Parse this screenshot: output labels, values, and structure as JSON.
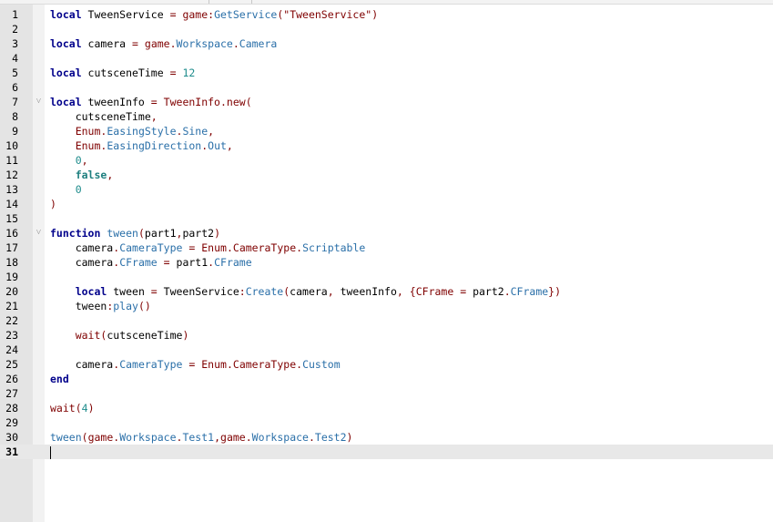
{
  "editor": {
    "current_line": "31",
    "lines": [
      {
        "n": "1",
        "tokens": [
          {
            "t": "local",
            "c": "kw"
          },
          {
            "t": " TweenService ",
            "c": "id"
          },
          {
            "t": "=",
            "c": "op"
          },
          {
            "t": " ",
            "c": "id"
          },
          {
            "t": "game",
            "c": "gl"
          },
          {
            "t": ":",
            "c": "op"
          },
          {
            "t": "GetService",
            "c": "mb"
          },
          {
            "t": "(",
            "c": "pn"
          },
          {
            "t": "\"TweenService\"",
            "c": "st"
          },
          {
            "t": ")",
            "c": "pn"
          }
        ]
      },
      {
        "n": "2",
        "tokens": []
      },
      {
        "n": "3",
        "tokens": [
          {
            "t": "local",
            "c": "kw"
          },
          {
            "t": " camera ",
            "c": "id"
          },
          {
            "t": "=",
            "c": "op"
          },
          {
            "t": " ",
            "c": "id"
          },
          {
            "t": "game",
            "c": "gl"
          },
          {
            "t": ".",
            "c": "op"
          },
          {
            "t": "Workspace",
            "c": "mb"
          },
          {
            "t": ".",
            "c": "op"
          },
          {
            "t": "Camera",
            "c": "mb"
          }
        ]
      },
      {
        "n": "4",
        "tokens": []
      },
      {
        "n": "5",
        "tokens": [
          {
            "t": "local",
            "c": "kw"
          },
          {
            "t": " cutsceneTime ",
            "c": "id"
          },
          {
            "t": "=",
            "c": "op"
          },
          {
            "t": " ",
            "c": "id"
          },
          {
            "t": "12",
            "c": "nm"
          }
        ]
      },
      {
        "n": "6",
        "tokens": []
      },
      {
        "n": "7",
        "fold": "˅",
        "tokens": [
          {
            "t": "local",
            "c": "kw"
          },
          {
            "t": " tweenInfo ",
            "c": "id"
          },
          {
            "t": "=",
            "c": "op"
          },
          {
            "t": " ",
            "c": "id"
          },
          {
            "t": "TweenInfo",
            "c": "gl"
          },
          {
            "t": ".",
            "c": "op"
          },
          {
            "t": "new",
            "c": "gl"
          },
          {
            "t": "(",
            "c": "pn"
          }
        ]
      },
      {
        "n": "8",
        "tokens": [
          {
            "t": "    cutsceneTime",
            "c": "id"
          },
          {
            "t": ",",
            "c": "op"
          }
        ]
      },
      {
        "n": "9",
        "tokens": [
          {
            "t": "    ",
            "c": "id"
          },
          {
            "t": "Enum",
            "c": "gl"
          },
          {
            "t": ".",
            "c": "op"
          },
          {
            "t": "EasingStyle",
            "c": "mb"
          },
          {
            "t": ".",
            "c": "op"
          },
          {
            "t": "Sine",
            "c": "mb"
          },
          {
            "t": ",",
            "c": "op"
          }
        ]
      },
      {
        "n": "10",
        "tokens": [
          {
            "t": "    ",
            "c": "id"
          },
          {
            "t": "Enum",
            "c": "gl"
          },
          {
            "t": ".",
            "c": "op"
          },
          {
            "t": "EasingDirection",
            "c": "mb"
          },
          {
            "t": ".",
            "c": "op"
          },
          {
            "t": "Out",
            "c": "mb"
          },
          {
            "t": ",",
            "c": "op"
          }
        ]
      },
      {
        "n": "11",
        "tokens": [
          {
            "t": "    ",
            "c": "id"
          },
          {
            "t": "0",
            "c": "nm"
          },
          {
            "t": ",",
            "c": "op"
          }
        ]
      },
      {
        "n": "12",
        "tokens": [
          {
            "t": "    ",
            "c": "id"
          },
          {
            "t": "false",
            "c": "bool"
          },
          {
            "t": ",",
            "c": "op"
          }
        ]
      },
      {
        "n": "13",
        "tokens": [
          {
            "t": "    ",
            "c": "id"
          },
          {
            "t": "0",
            "c": "nm"
          }
        ]
      },
      {
        "n": "14",
        "tokens": [
          {
            "t": ")",
            "c": "pn"
          }
        ]
      },
      {
        "n": "15",
        "tokens": []
      },
      {
        "n": "16",
        "fold": "˅",
        "tokens": [
          {
            "t": "function",
            "c": "kw"
          },
          {
            "t": " ",
            "c": "id"
          },
          {
            "t": "tween",
            "c": "fn"
          },
          {
            "t": "(",
            "c": "pn"
          },
          {
            "t": "part1",
            "c": "id"
          },
          {
            "t": ",",
            "c": "op"
          },
          {
            "t": "part2",
            "c": "id"
          },
          {
            "t": ")",
            "c": "pn"
          }
        ]
      },
      {
        "n": "17",
        "tokens": [
          {
            "t": "    camera",
            "c": "id"
          },
          {
            "t": ".",
            "c": "op"
          },
          {
            "t": "CameraType",
            "c": "mb"
          },
          {
            "t": " ",
            "c": "id"
          },
          {
            "t": "=",
            "c": "op"
          },
          {
            "t": " ",
            "c": "id"
          },
          {
            "t": "Enum",
            "c": "gl"
          },
          {
            "t": ".",
            "c": "op"
          },
          {
            "t": "CameraType",
            "c": "gl"
          },
          {
            "t": ".",
            "c": "op"
          },
          {
            "t": "Scriptable",
            "c": "mb"
          }
        ]
      },
      {
        "n": "18",
        "tokens": [
          {
            "t": "    camera",
            "c": "id"
          },
          {
            "t": ".",
            "c": "op"
          },
          {
            "t": "CFrame",
            "c": "mb"
          },
          {
            "t": " ",
            "c": "id"
          },
          {
            "t": "=",
            "c": "op"
          },
          {
            "t": " part1",
            "c": "id"
          },
          {
            "t": ".",
            "c": "op"
          },
          {
            "t": "CFrame",
            "c": "mb"
          }
        ]
      },
      {
        "n": "19",
        "tokens": []
      },
      {
        "n": "20",
        "tokens": [
          {
            "t": "    ",
            "c": "id"
          },
          {
            "t": "local",
            "c": "kw"
          },
          {
            "t": " tween ",
            "c": "id"
          },
          {
            "t": "=",
            "c": "op"
          },
          {
            "t": " TweenService",
            "c": "id"
          },
          {
            "t": ":",
            "c": "op"
          },
          {
            "t": "Create",
            "c": "mb"
          },
          {
            "t": "(",
            "c": "pn"
          },
          {
            "t": "camera",
            "c": "id"
          },
          {
            "t": ",",
            "c": "op"
          },
          {
            "t": " tweenInfo",
            "c": "id"
          },
          {
            "t": ",",
            "c": "op"
          },
          {
            "t": " ",
            "c": "id"
          },
          {
            "t": "{",
            "c": "pn"
          },
          {
            "t": "CFrame",
            "c": "gl"
          },
          {
            "t": " ",
            "c": "id"
          },
          {
            "t": "=",
            "c": "op"
          },
          {
            "t": " part2",
            "c": "id"
          },
          {
            "t": ".",
            "c": "op"
          },
          {
            "t": "CFrame",
            "c": "mb"
          },
          {
            "t": "})",
            "c": "pn"
          }
        ]
      },
      {
        "n": "21",
        "tokens": [
          {
            "t": "    tween",
            "c": "id"
          },
          {
            "t": ":",
            "c": "op"
          },
          {
            "t": "play",
            "c": "mb"
          },
          {
            "t": "()",
            "c": "pn"
          }
        ]
      },
      {
        "n": "22",
        "tokens": []
      },
      {
        "n": "23",
        "tokens": [
          {
            "t": "    ",
            "c": "id"
          },
          {
            "t": "wait",
            "c": "gl"
          },
          {
            "t": "(",
            "c": "pn"
          },
          {
            "t": "cutsceneTime",
            "c": "id"
          },
          {
            "t": ")",
            "c": "pn"
          }
        ]
      },
      {
        "n": "24",
        "tokens": []
      },
      {
        "n": "25",
        "tokens": [
          {
            "t": "    camera",
            "c": "id"
          },
          {
            "t": ".",
            "c": "op"
          },
          {
            "t": "CameraType",
            "c": "mb"
          },
          {
            "t": " ",
            "c": "id"
          },
          {
            "t": "=",
            "c": "op"
          },
          {
            "t": " ",
            "c": "id"
          },
          {
            "t": "Enum",
            "c": "gl"
          },
          {
            "t": ".",
            "c": "op"
          },
          {
            "t": "CameraType",
            "c": "gl"
          },
          {
            "t": ".",
            "c": "op"
          },
          {
            "t": "Custom",
            "c": "mb"
          }
        ]
      },
      {
        "n": "26",
        "tokens": [
          {
            "t": "end",
            "c": "kw"
          }
        ]
      },
      {
        "n": "27",
        "tokens": []
      },
      {
        "n": "28",
        "tokens": [
          {
            "t": "wait",
            "c": "gl"
          },
          {
            "t": "(",
            "c": "pn"
          },
          {
            "t": "4",
            "c": "nm"
          },
          {
            "t": ")",
            "c": "pn"
          }
        ]
      },
      {
        "n": "29",
        "tokens": []
      },
      {
        "n": "30",
        "tokens": [
          {
            "t": "tween",
            "c": "fn"
          },
          {
            "t": "(",
            "c": "pn"
          },
          {
            "t": "game",
            "c": "gl"
          },
          {
            "t": ".",
            "c": "op"
          },
          {
            "t": "Workspace",
            "c": "mb"
          },
          {
            "t": ".",
            "c": "op"
          },
          {
            "t": "Test1",
            "c": "mb"
          },
          {
            "t": ",",
            "c": "op"
          },
          {
            "t": "game",
            "c": "gl"
          },
          {
            "t": ".",
            "c": "op"
          },
          {
            "t": "Workspace",
            "c": "mb"
          },
          {
            "t": ".",
            "c": "op"
          },
          {
            "t": "Test2",
            "c": "mb"
          },
          {
            "t": ")",
            "c": "pn"
          }
        ]
      },
      {
        "n": "31",
        "tokens": []
      }
    ]
  }
}
